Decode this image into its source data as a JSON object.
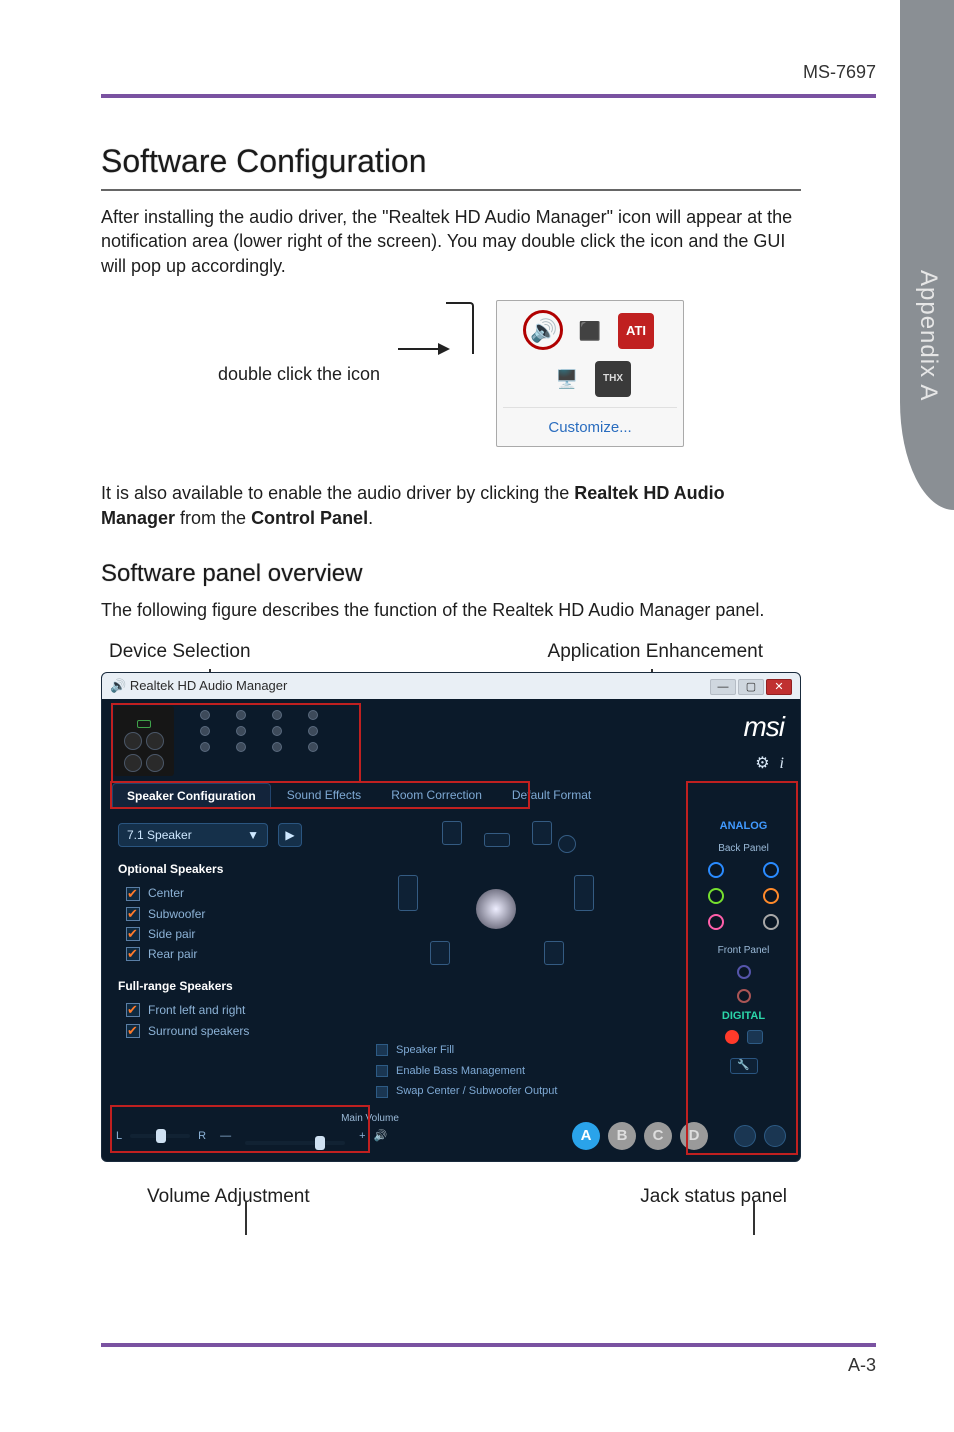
{
  "page": {
    "model": "MS-7697",
    "appendix_tab": "Appendix A",
    "page_number": "A-3"
  },
  "section": {
    "title": "Software Configuration",
    "intro": "After installing the audio driver, the \"Realtek HD Audio Manager\" icon will appear at the notification area (lower right of the screen). You may double click the icon and the GUI will pop up accordingly.",
    "dbl_click_label": "double click the icon",
    "tray": {
      "customize": "Customize..."
    },
    "also_pre": "It is also available to enable the audio driver by clicking the ",
    "also_bold1": "Realtek HD Audio Manager",
    "also_mid": " from the ",
    "also_bold2": "Control Panel",
    "also_post": "."
  },
  "overview": {
    "title": "Software panel overview",
    "desc": "The following figure describes the function of the Realtek HD Audio Manager panel.",
    "anno_device": "Device Selection",
    "anno_app": "Application Enhancement",
    "anno_volume": "Volume Adjustment",
    "anno_jack": "Jack status panel"
  },
  "app": {
    "title": "Realtek HD Audio Manager",
    "brand": "msi",
    "tabs": {
      "speaker": "Speaker Configuration",
      "effects": "Sound Effects",
      "room": "Room Correction",
      "format": "Default Format"
    },
    "speaker_mode": "7.1 Speaker",
    "optional_title": "Optional Speakers",
    "opts": {
      "center": "Center",
      "sub": "Subwoofer",
      "side": "Side pair",
      "rear": "Rear pair"
    },
    "fullrange_title": "Full-range Speakers",
    "fullrange": {
      "front": "Front left and right",
      "surround": "Surround speakers"
    },
    "toggles": {
      "fill": "Speaker Fill",
      "bass": "Enable Bass Management",
      "swap": "Swap Center / Subwoofer Output"
    },
    "panel": {
      "analog": "ANALOG",
      "back": "Back Panel",
      "front": "Front Panel",
      "digital": "DIGITAL"
    },
    "volume": {
      "label": "Main Volume",
      "L": "L",
      "R": "R"
    },
    "thx": {
      "A": "A",
      "B": "B",
      "C": "C",
      "D": "D"
    }
  }
}
